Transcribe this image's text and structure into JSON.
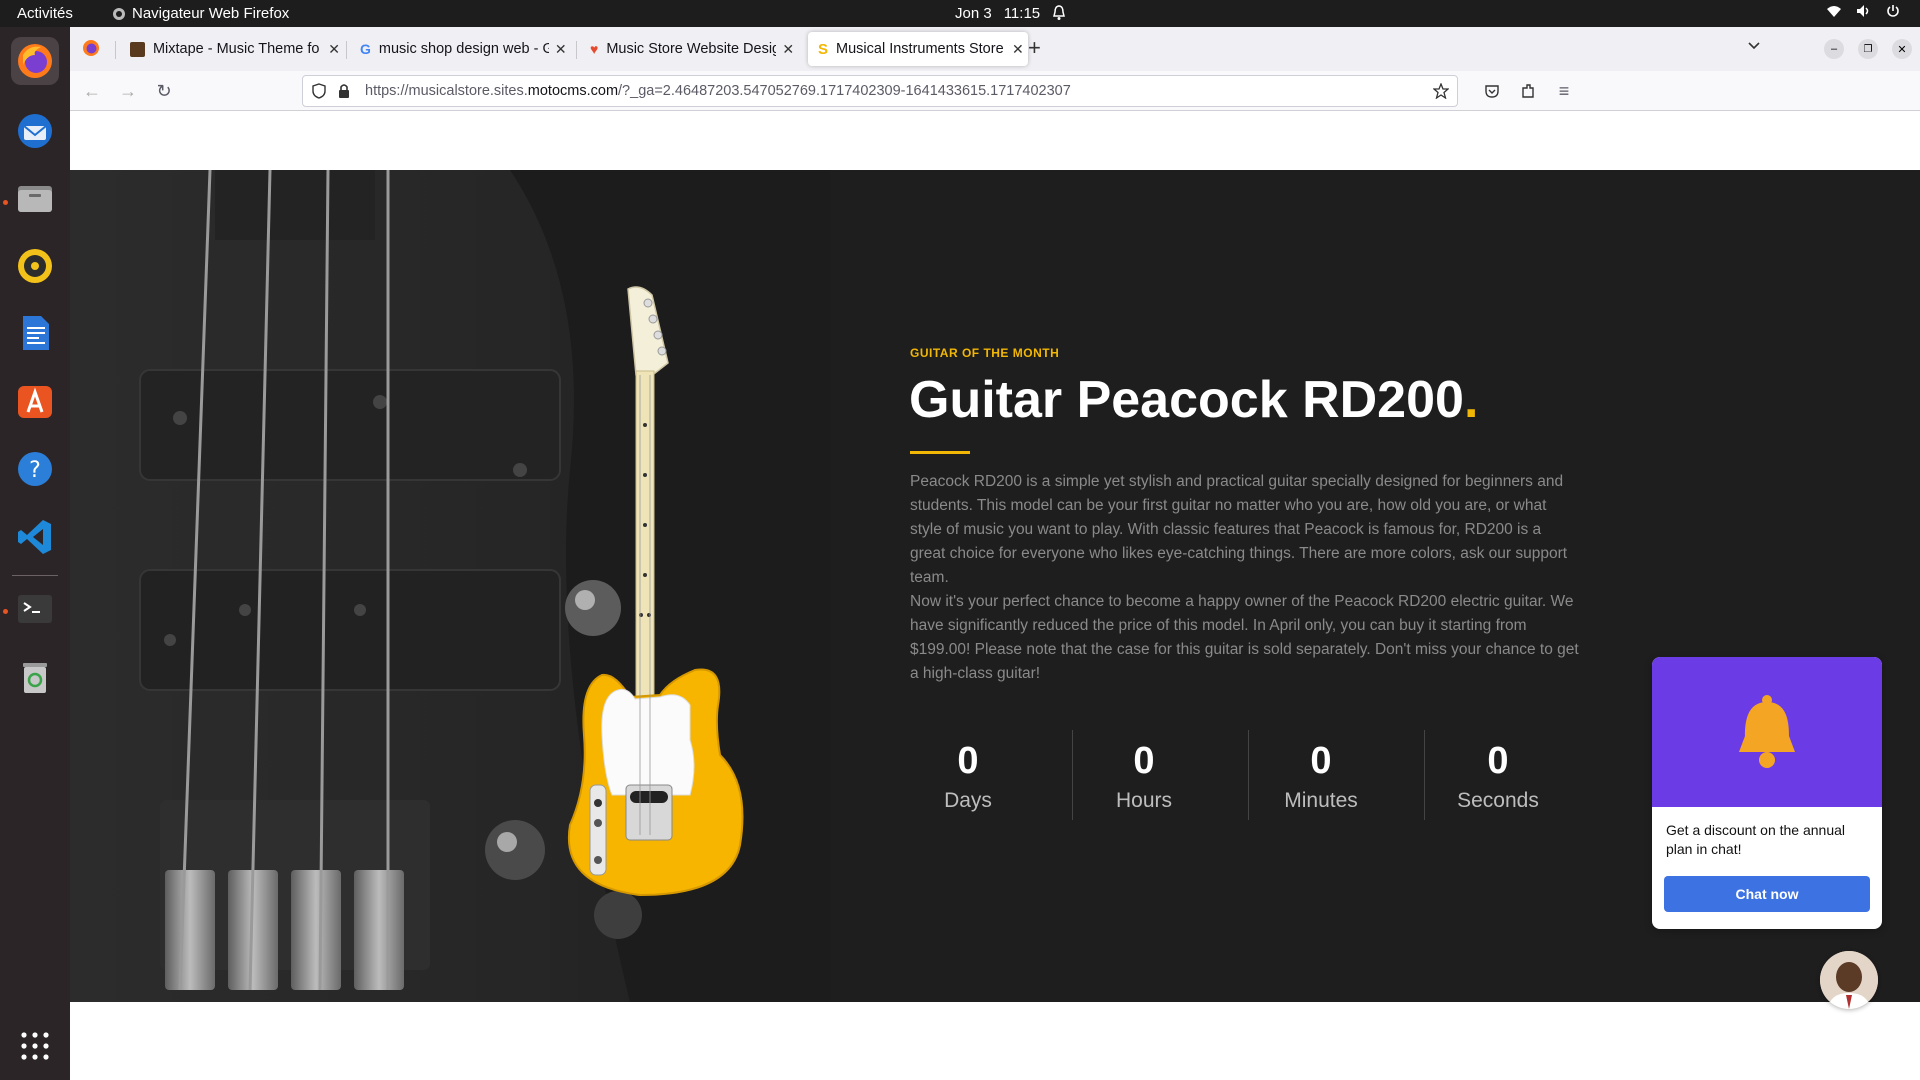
{
  "system": {
    "activities": "Activités",
    "app_name": "Navigateur Web Firefox",
    "date": "Jon 3",
    "time": "11:15"
  },
  "browser": {
    "tabs": [
      {
        "title": "Mixtape - Music Theme fo",
        "icon": "mixtape-favicon"
      },
      {
        "title": "music shop design web - G",
        "icon": "google-favicon"
      },
      {
        "title": "Music Store Website Desig",
        "icon": "heart-favicon"
      },
      {
        "title": "Musical Instruments Store",
        "icon": "s-favicon",
        "active": true
      }
    ],
    "url_prefix": "https://musicalstore.sites.",
    "url_domain": "motocms.com",
    "url_suffix": "/?_ga=2.46487203.547052769.1717402309-1641433615.1717402307"
  },
  "hero": {
    "eyebrow": "GUITAR OF THE MONTH",
    "title": "Guitar Peacock RD200",
    "title_dot": ".",
    "paragraph1": "Peacock RD200 is a simple yet stylish and practical guitar specially designed for beginners and students. This model can be your first guitar no matter who you are, how old you are, or what style of music you want to play. With classic features that Peacock is famous for, RD200 is a great choice for everyone who likes eye-catching things. There are more colors, ask our support team.",
    "paragraph2": "Now it's your perfect chance to become a happy owner of the Peacock RD200 electric guitar. We have significantly reduced the price of this model. In April only, you can buy it starting from $199.00! Please note that the case for this guitar is sold separately. Don't miss your chance to get a high-class guitar!",
    "countdown": [
      {
        "value": "0",
        "label": "Days"
      },
      {
        "value": "0",
        "label": "Hours"
      },
      {
        "value": "0",
        "label": "Minutes"
      },
      {
        "value": "0",
        "label": "Seconds"
      }
    ]
  },
  "chat": {
    "message": "Get a discount on the annual plan in chat!",
    "button": "Chat now"
  },
  "colors": {
    "accent": "#f2b705",
    "hero_bg": "#1e1e1e",
    "chat_purple": "#6b3ce6",
    "chat_button": "#3c72e2"
  }
}
